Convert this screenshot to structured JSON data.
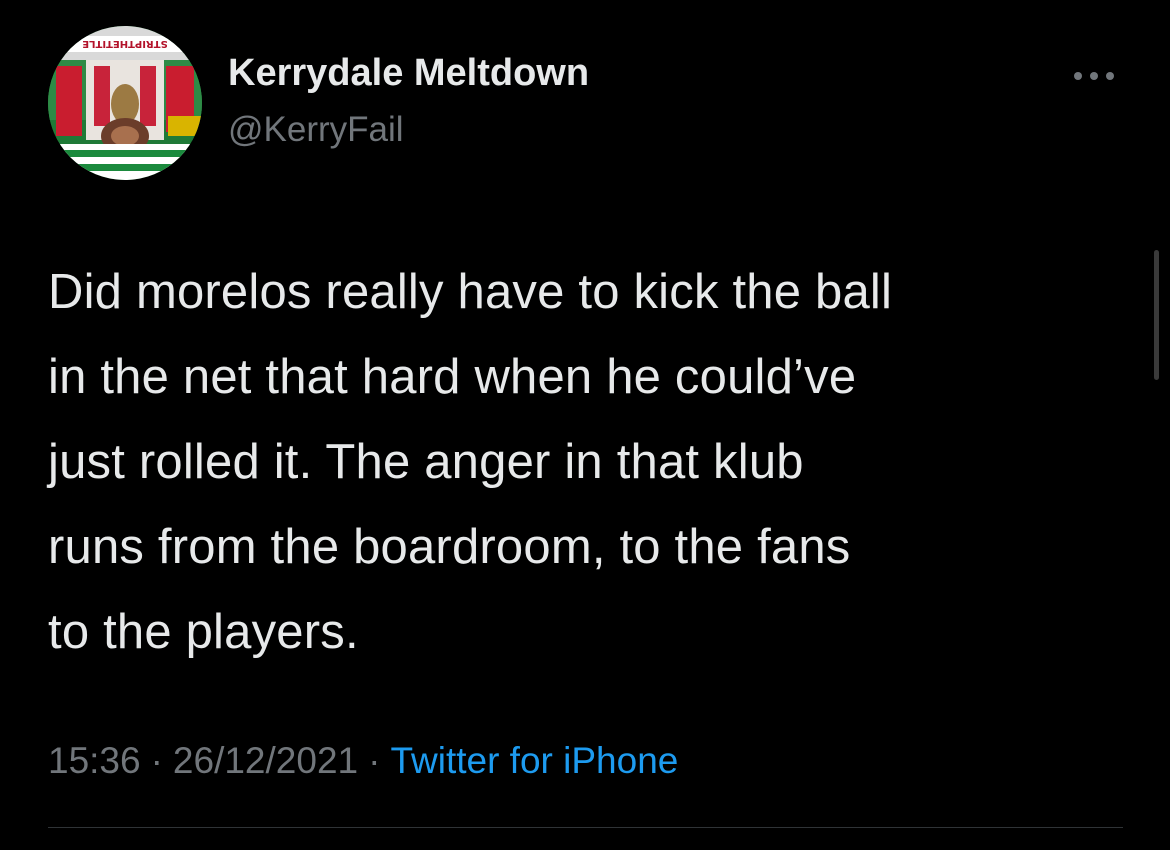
{
  "tweet": {
    "author": {
      "display_name": "Kerrydale Meltdown",
      "handle": "@KerryFail",
      "avatar_banner_text": "STRIPTHETITLE"
    },
    "text_lines": [
      "Did morelos really have to kick the ball",
      "in the net that hard when he could’ve",
      "just rolled it. The anger in that klub",
      "runs from the boardroom, to the fans",
      "to the players."
    ],
    "time": "15:36",
    "date": "26/12/2021",
    "separator": "·",
    "source": "Twitter for iPhone"
  },
  "icons": {
    "more": "more-horizontal-icon"
  },
  "colors": {
    "background": "#000000",
    "text_primary": "#e7e9ea",
    "text_secondary": "#71767b",
    "link": "#1d9bf0",
    "divider": "#2f3336"
  }
}
